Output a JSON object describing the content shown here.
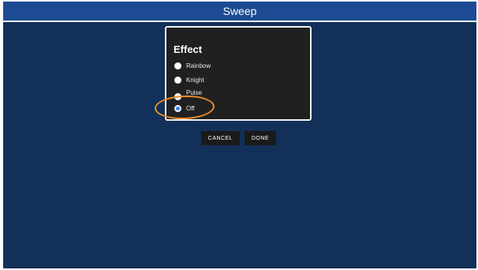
{
  "header": {
    "title": "Sweep"
  },
  "dialog": {
    "title": "Effect",
    "options": [
      {
        "label": "Rainbow",
        "selected": false
      },
      {
        "label": "Knight",
        "selected": false
      },
      {
        "label": "Pulse",
        "selected": false
      },
      {
        "label": "Off",
        "selected": true
      }
    ]
  },
  "buttons": {
    "cancel_label": "CANCEL",
    "done_label": "DONE"
  },
  "colors": {
    "background": "#123059",
    "header": "#1c4b93",
    "dialog": "#202020",
    "selected_radio": "#2f7ef6",
    "highlight": "#e88c2d"
  }
}
